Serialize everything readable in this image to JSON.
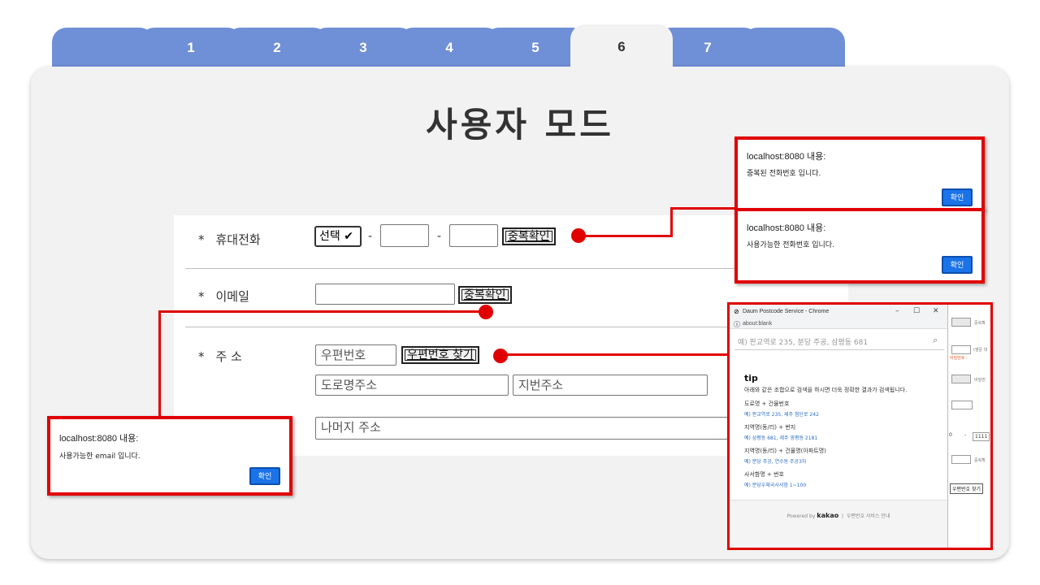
{
  "tabs": [
    "",
    "1",
    "2",
    "3",
    "4",
    "5",
    "6",
    "7",
    ""
  ],
  "active_tab": "6",
  "page_title": "사용자 모드",
  "form": {
    "phone": {
      "label": "휴대전화",
      "select_value": "선택 ✔",
      "dash": "-",
      "button": "중복확인"
    },
    "email": {
      "label": "이메일",
      "button": "중복확인"
    },
    "address": {
      "label": "주 소",
      "postcode_placeholder": "우편번호",
      "find_button": "우편번호 찾기",
      "road_placeholder": "도로명주소",
      "jibun_placeholder": "지번주소",
      "rest_placeholder": "나머지 주소"
    },
    "star": "*"
  },
  "alerts": {
    "dup_phone": {
      "title": "localhost:8080 내용:",
      "message": "중복된 전화번호 입니다.",
      "button": "확인"
    },
    "ok_phone": {
      "title": "localhost:8080 내용:",
      "message": "사용가능한 전화번호 입니다.",
      "button": "확인"
    },
    "ok_email": {
      "title": "localhost:8080 내용:",
      "message": "사용가능한 email 입니다.",
      "button": "확인"
    }
  },
  "popup": {
    "window_title": "Daum Postcode Service - Chrome",
    "url": "about:blank",
    "controls": [
      "–",
      "☐",
      "✕"
    ],
    "search_placeholder": "예) 판교역로 235, 분당 주공, 삼평동 681",
    "tip_title": "tip",
    "tip_desc": "아래와 같은 조합으로 검색을 하시면 더욱 정확한 결과가 검색됩니다.",
    "examples": [
      {
        "label": "도로명 + 건물번호",
        "value": "예) 판교역로 235,  제주 첨단로 242"
      },
      {
        "label": "지역명(동/리) + 번지",
        "value": "예) 삼평동 681,  제주 영평동 2181"
      },
      {
        "label": "지역명(동/리) + 건물명(아파트명)",
        "value": "예) 분당 주공,  연수동 주공3차"
      },
      {
        "label": "사서함명 + 번호",
        "value": "예) 분당우체국사서함 1~100"
      }
    ],
    "footer_powered": "Powered by",
    "footer_brand": "kakao",
    "footer_link": "우편번호 서비스 안내",
    "side": {
      "dup": "중복확",
      "english": "(영문 대",
      "pw_hint": "비밀번호 :",
      "pw": "비밀번",
      "phone_num": "1111",
      "phone_prefix": "0",
      "dash": "-",
      "dup2": "중복확",
      "postcode_btn": "우편번호 찾기"
    }
  },
  "colors": {
    "tab": "#6f8fd6",
    "highlight": "#e00000",
    "confirm": "#1a73e8"
  }
}
